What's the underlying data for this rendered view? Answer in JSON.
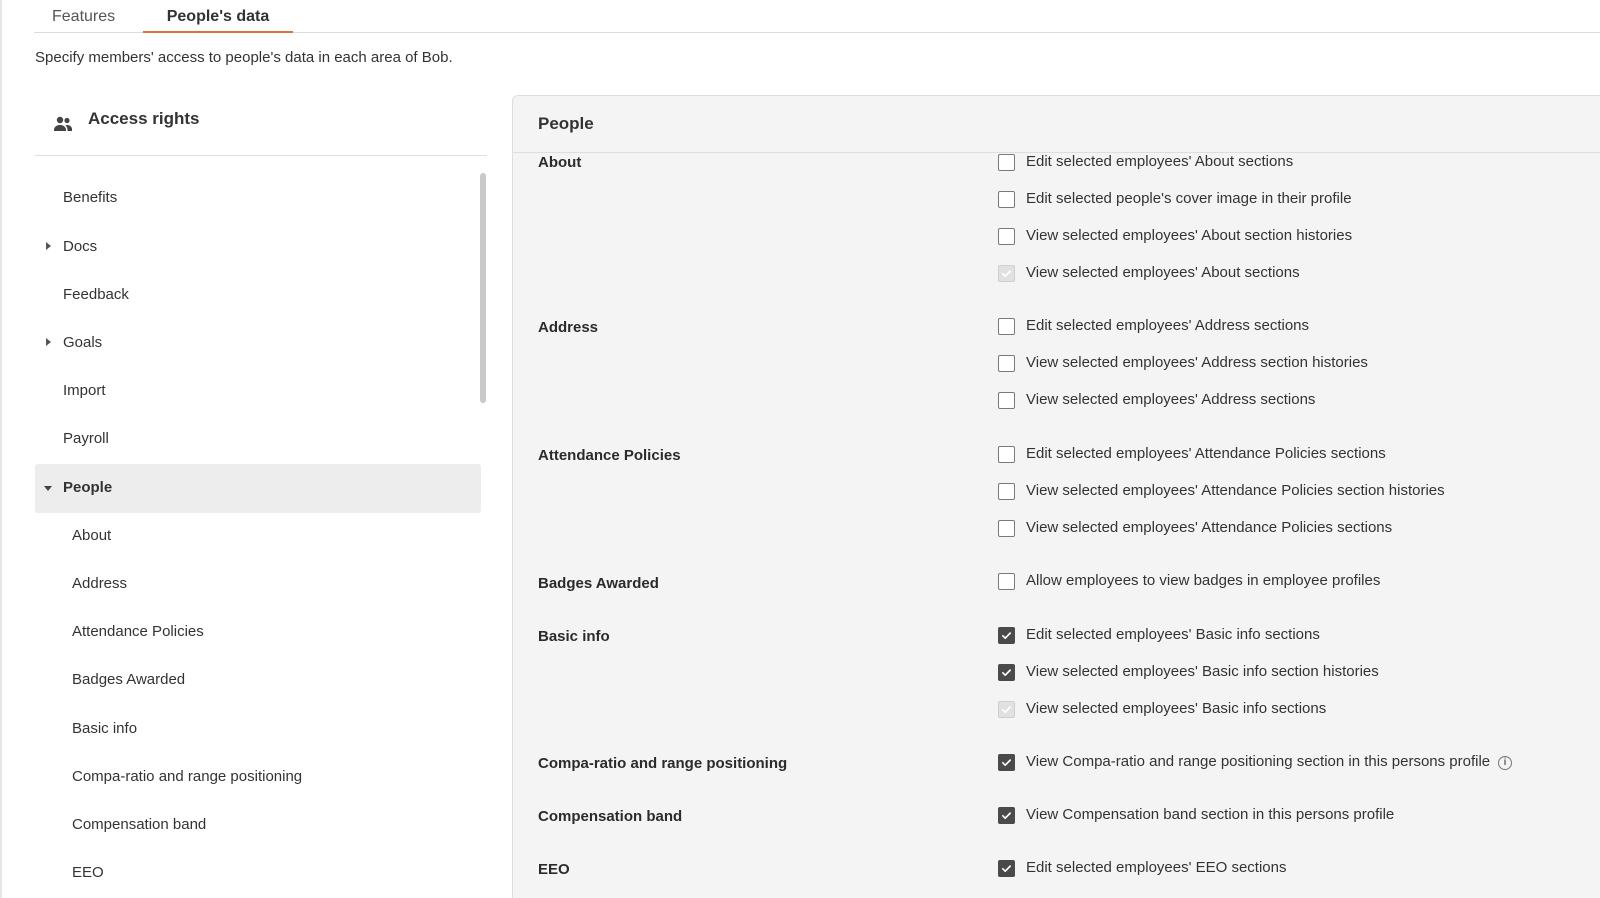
{
  "tabs": [
    {
      "label": "Features",
      "active": false
    },
    {
      "label": "People's data",
      "active": true
    }
  ],
  "description": "Specify members' access to people's data in each area of Bob.",
  "left_panel": {
    "icon": "people-icon",
    "title": "Access rights",
    "items": [
      {
        "label": "Benefits",
        "expandable": false
      },
      {
        "label": "Docs",
        "expandable": true,
        "expanded": false
      },
      {
        "label": "Feedback",
        "expandable": false
      },
      {
        "label": "Goals",
        "expandable": true,
        "expanded": false
      },
      {
        "label": "Import",
        "expandable": false
      },
      {
        "label": "Payroll",
        "expandable": false
      },
      {
        "label": "People",
        "expandable": true,
        "expanded": true,
        "selected": true
      },
      {
        "label": "About",
        "sub": true
      },
      {
        "label": "Address",
        "sub": true
      },
      {
        "label": "Attendance Policies",
        "sub": true
      },
      {
        "label": "Badges Awarded",
        "sub": true
      },
      {
        "label": "Basic info",
        "sub": true
      },
      {
        "label": "Compa-ratio and range positioning",
        "sub": true
      },
      {
        "label": "Compensation band",
        "sub": true
      },
      {
        "label": "EEO",
        "sub": true
      }
    ]
  },
  "right_panel": {
    "title": "People",
    "sections": [
      {
        "label": "About",
        "permissions": [
          {
            "text": "Edit selected employees' About sections",
            "state": "unchecked"
          },
          {
            "text": "Edit selected people's cover image in their profile",
            "state": "unchecked"
          },
          {
            "text": "View selected employees' About section histories",
            "state": "unchecked"
          },
          {
            "text": "View selected employees' About sections",
            "state": "checked-disabled"
          }
        ]
      },
      {
        "label": "Address",
        "permissions": [
          {
            "text": "Edit selected employees' Address sections",
            "state": "unchecked"
          },
          {
            "text": "View selected employees' Address section histories",
            "state": "unchecked"
          },
          {
            "text": "View selected employees' Address sections",
            "state": "unchecked"
          }
        ]
      },
      {
        "label": "Attendance Policies",
        "permissions": [
          {
            "text": "Edit selected employees' Attendance Policies sections",
            "state": "unchecked"
          },
          {
            "text": "View selected employees' Attendance Policies section histories",
            "state": "unchecked"
          },
          {
            "text": "View selected employees' Attendance Policies sections",
            "state": "unchecked"
          }
        ]
      },
      {
        "label": "Badges Awarded",
        "permissions": [
          {
            "text": "Allow employees to view badges in employee profiles",
            "state": "unchecked"
          }
        ]
      },
      {
        "label": "Basic info",
        "permissions": [
          {
            "text": "Edit selected employees' Basic info sections",
            "state": "checked"
          },
          {
            "text": "View selected employees' Basic info section histories",
            "state": "checked"
          },
          {
            "text": "View selected employees' Basic info sections",
            "state": "checked-disabled"
          }
        ]
      },
      {
        "label": "Compa-ratio and range positioning",
        "permissions": [
          {
            "text": "View Compa-ratio and range positioning section in this persons profile",
            "state": "checked",
            "info": true
          }
        ]
      },
      {
        "label": "Compensation band",
        "permissions": [
          {
            "text": "View Compensation band section in this persons profile",
            "state": "checked"
          }
        ]
      },
      {
        "label": "EEO",
        "permissions": [
          {
            "text": "Edit selected employees' EEO sections",
            "state": "checked"
          }
        ]
      }
    ]
  },
  "icons": {
    "info": "info-icon",
    "check": "check-icon"
  },
  "colors": {
    "tab_underline": "#e0723a",
    "checkbox_checked": "#4a4a4a",
    "checkbox_disabled": "#e1e1e1",
    "panel_bg": "#f4f4f4",
    "selected_item_bg": "#ededed"
  }
}
